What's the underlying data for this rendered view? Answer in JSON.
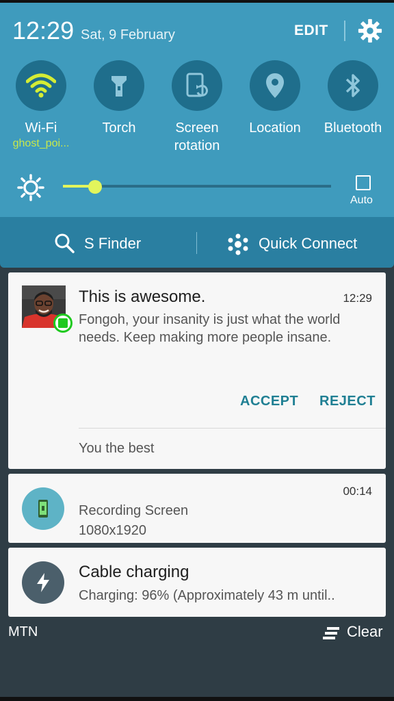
{
  "status": {
    "time": "12:29",
    "date": "Sat, 9 February",
    "edit_label": "EDIT"
  },
  "quick_settings": {
    "tiles": [
      {
        "label": "Wi-Fi",
        "sub": "ghost_poi...",
        "icon": "wifi-icon",
        "active": true
      },
      {
        "label": "Torch",
        "sub": "",
        "icon": "torch-icon",
        "active": false
      },
      {
        "label": "Screen rotation",
        "sub": "",
        "icon": "screen-rotation-icon",
        "active": false
      },
      {
        "label": "Location",
        "sub": "",
        "icon": "location-icon",
        "active": false
      },
      {
        "label": "Bluetooth",
        "sub": "",
        "icon": "bluetooth-icon",
        "active": false
      }
    ],
    "brightness_level": 0.12,
    "auto_label": "Auto"
  },
  "finder_bar": {
    "s_finder": "S Finder",
    "quick_connect": "Quick Connect"
  },
  "notifications": {
    "message": {
      "title": "This is awesome.",
      "time": "12:29",
      "body": "Fongoh, your insanity is just what the world needs. Keep making more people insane.",
      "accept": "ACCEPT",
      "reject": "REJECT",
      "reply": "You the best"
    },
    "recording": {
      "time": "00:14",
      "title": "Recording Screen",
      "sub": "1080x1920"
    },
    "charging": {
      "title": "Cable charging",
      "sub": "Charging: 96% (Approximately 43 m until.."
    }
  },
  "footer": {
    "carrier": "MTN",
    "clear": "Clear"
  },
  "colors": {
    "shade": "#3f9bbd",
    "tile_circle": "#1f6e8c",
    "accent_yellow": "#e2f55c",
    "action_teal": "#1f7f93"
  }
}
